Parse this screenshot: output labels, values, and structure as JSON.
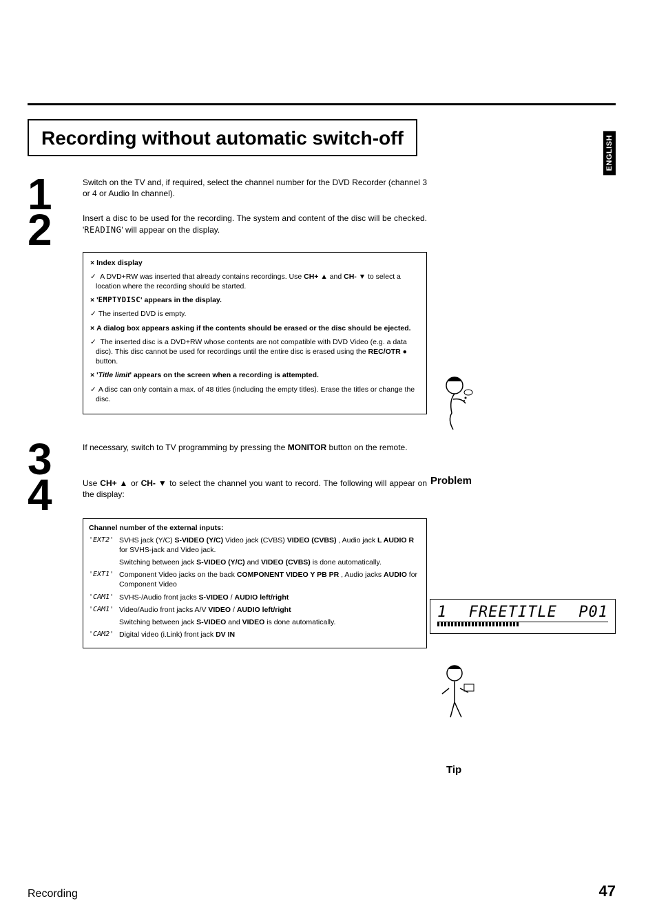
{
  "side_tab": "ENGLISH",
  "title": "Recording without automatic switch-off",
  "steps": {
    "s1_num": "1",
    "s1_text_a": "Switch on the TV and, if required, select the channel number for the DVD Recorder (channel 3 or 4 or Audio In channel).",
    "s2_num": "2",
    "s2_text_a": "Insert a disc to be used for the recording. The system and content of the disc will be checked. '",
    "s2_code": "READING",
    "s2_text_b": "' will appear on the display.",
    "s3_num": "3",
    "s3_text_a": "If necessary, switch to TV programming by pressing the ",
    "s3_bold": "MONITOR",
    "s3_text_b": " button on the remote.",
    "s4_num": "4",
    "s4_text_a": "Use ",
    "s4_b1": "CH+ ▲",
    "s4_mid": " or ",
    "s4_b2": "CH- ▼",
    "s4_text_b": " to select the channel you want to record. The following will appear on the display:"
  },
  "problembox": {
    "h1": "Index display",
    "l1a": "A DVD+RW was inserted that already contains recordings. Use ",
    "l1b1": "CH+ ▲",
    "l1mid": " and ",
    "l1b2": "CH- ▼",
    "l1c": " to select a location where the recording should be started.",
    "h2a": "'",
    "h2code": "EMPTYDISC",
    "h2b": "' appears in the display.",
    "l2": "The inserted DVD is empty.",
    "h3": "A dialog box appears asking if the contents should be erased or the disc should be ejected.",
    "l3a": "The inserted disc is a DVD+RW whose contents are not compatible with DVD Video (e.g. a data disc). This disc cannot be used for recordings until the entire disc is erased using the ",
    "l3b": "REC/OTR ●",
    "l3c": " button.",
    "h4a": "'",
    "h4i": "Title limit",
    "h4b": "' appears on the screen when a recording is attempted.",
    "l4": "A disc can only contain a max. of 48 titles (including the empty titles). Erase the titles or change the disc.",
    "label": "Problem"
  },
  "tipbox": {
    "head": "Channel number of the external inputs:",
    "r1_code": "'EXT2'",
    "r1_a": "SVHS jack (Y/C) ",
    "r1_b1": "S-VIDEO (Y/C)",
    "r1_mid1": " Video jack (CVBS) ",
    "r1_b2": "VIDEO (CVBS)",
    "r1_mid2": " , Audio jack ",
    "r1_b3": "L AUDIO R",
    "r1_tail": " for SVHS-jack and Video jack.",
    "r1x_a": "Switching between jack ",
    "r1x_b1": "S-VIDEO (Y/C)",
    "r1x_mid": " and ",
    "r1x_b2": "VIDEO (CVBS)",
    "r1x_tail": " is done automatically.",
    "r2_code": "'EXT1'",
    "r2_a": "Component Video jacks on the back ",
    "r2_b1": "COMPONENT VIDEO Y PB PR",
    "r2_mid": " , Audio jacks ",
    "r2_b2": "AUDIO",
    "r2_tail": " for Component Video",
    "r3_code": "'CAM1'",
    "r3_a": "SVHS-/Audio front jacks ",
    "r3_b1": "S-VIDEO",
    "r3_mid": " / ",
    "r3_b2": "AUDIO left/right",
    "r4_code": "'CAM1'",
    "r4_a": "Video/Audio front jacks A/V ",
    "r4_b1": "VIDEO",
    "r4_mid": " / ",
    "r4_b2": "AUDIO left/right",
    "r4x_a": "Switching between jack ",
    "r4x_b1": "S-VIDEO",
    "r4x_mid": " and ",
    "r4x_b2": "VIDEO",
    "r4x_tail": " is done automatically.",
    "r5_code": "'CAM2'",
    "r5_a": "Digital video (i.Link) front jack ",
    "r5_b1": "DV IN",
    "label": "Tip"
  },
  "display": {
    "left_num": "1",
    "title": "FREETITLE",
    "right": "P01"
  },
  "footer": {
    "left": "Recording",
    "right": "47"
  }
}
